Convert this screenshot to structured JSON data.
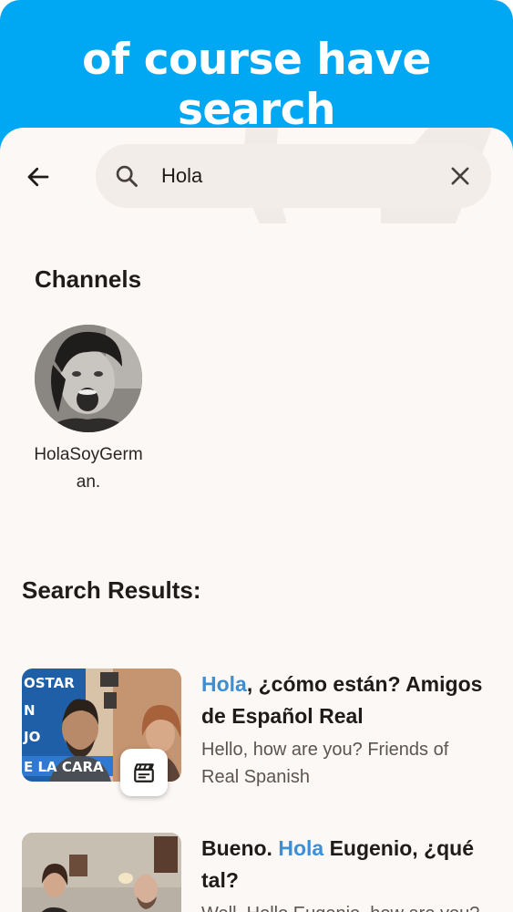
{
  "banner": {
    "title": "of course have search"
  },
  "search": {
    "value": "Hola"
  },
  "icons": {
    "back": "arrow-left-icon",
    "search": "search-icon",
    "clear": "close-icon",
    "clip": "clapperboard-icon"
  },
  "channels": {
    "heading": "Channels",
    "items": [
      {
        "name": "HolaSoyGerman."
      }
    ]
  },
  "results": {
    "heading": "Search Results:",
    "items": [
      {
        "title_before": "",
        "title_highlight": "Hola",
        "title_after": ", ¿cómo están? Amigos de Español Real",
        "subtitle": "Hello, how are you? Friends of Real Spanish",
        "thumb_text": [
          "OSTAR",
          "N",
          "JO",
          "E LA CARA"
        ]
      },
      {
        "title_before": "Bueno. ",
        "title_highlight": "Hola",
        "title_after": " Eugenio, ¿qué tal?",
        "subtitle": "Well. Hello Eugenio, how are you?"
      }
    ]
  },
  "colors": {
    "banner": "#00a8f3",
    "background": "#fcf8f5",
    "search_bg": "#f3ede9",
    "highlight": "#3a8fd6"
  }
}
